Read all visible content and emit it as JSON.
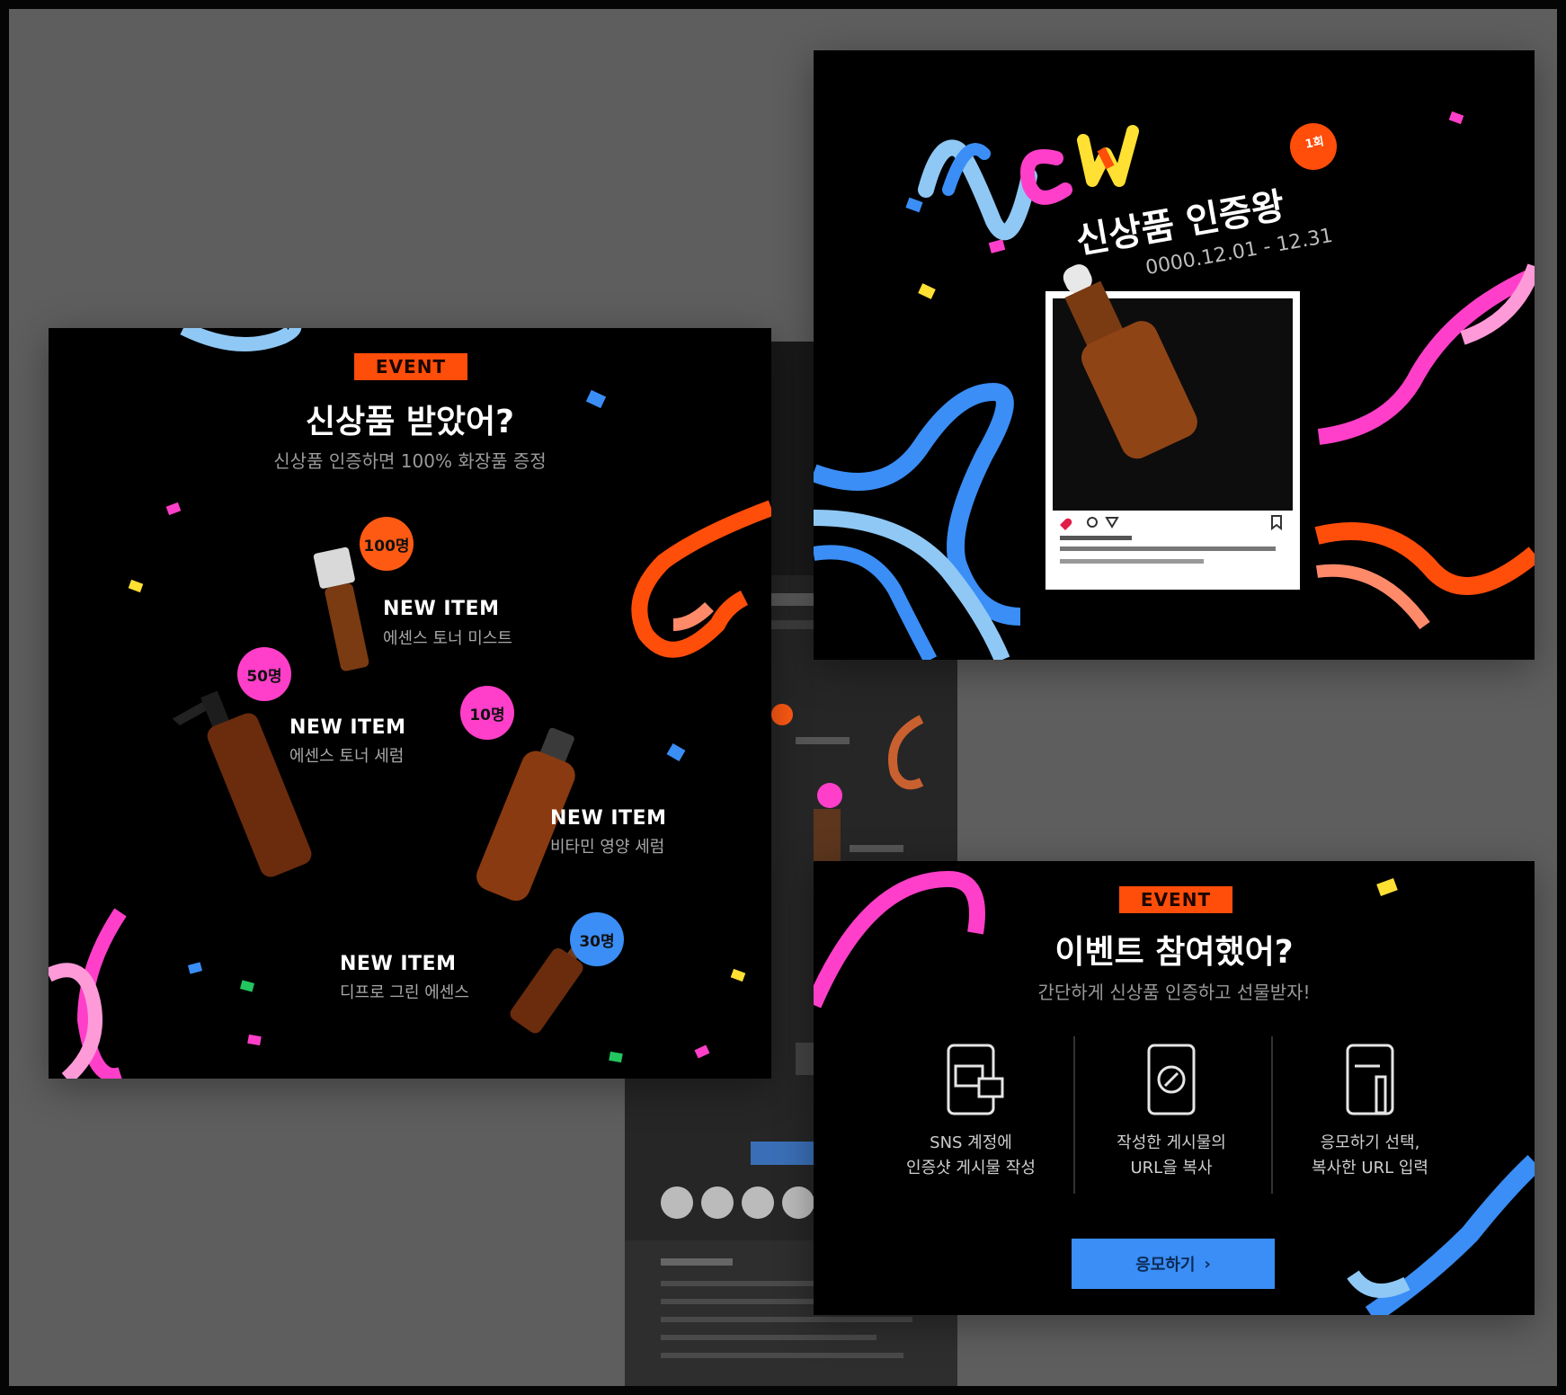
{
  "left_card": {
    "event_badge": "EVENT",
    "title": "신상품 받았어?",
    "subtitle": "신상품 인증하면 100% 화장품 증정",
    "items": [
      {
        "badge": "100명",
        "label": "NEW ITEM",
        "desc": "에센스 토너 미스트",
        "badge_color": "#ff5a14"
      },
      {
        "badge": "50명",
        "label": "NEW ITEM",
        "desc": "에센스 토너 세럼",
        "badge_color": "#ff3fc9"
      },
      {
        "badge": "10명",
        "label": "NEW ITEM",
        "desc": "비타민 영양 세럼",
        "badge_color": "#ff3fc9"
      },
      {
        "badge": "30명",
        "label": "NEW ITEM",
        "desc": "디프로 그린 에센스",
        "badge_color": "#3a8ef6"
      }
    ]
  },
  "top_right_card": {
    "logo_word": "New",
    "round_badge": "1회",
    "title": "신상품 인증왕",
    "date_range": "0000.12.01 - 12.31"
  },
  "bottom_right_card": {
    "event_badge": "EVENT",
    "title": "이벤트 참여했어?",
    "subtitle": "간단하게 신상품 인증하고 선물받자!",
    "steps": [
      {
        "icon": "sns-post-icon",
        "line1": "SNS 계정에",
        "line2": "인증샷 게시물 작성"
      },
      {
        "icon": "copy-url-icon",
        "line1": "작성한 게시물의",
        "line2": "URL을 복사"
      },
      {
        "icon": "enter-url-icon",
        "line1": "응모하기 선택,",
        "line2": "복사한 URL 입력"
      }
    ],
    "cta_label": "응모하기"
  },
  "colors": {
    "orange": "#ff4d0a",
    "pink": "#ff3fc9",
    "blue": "#3a8ef6",
    "light_blue": "#8fc8f5",
    "yellow": "#ffe033",
    "green": "#22c55e"
  }
}
